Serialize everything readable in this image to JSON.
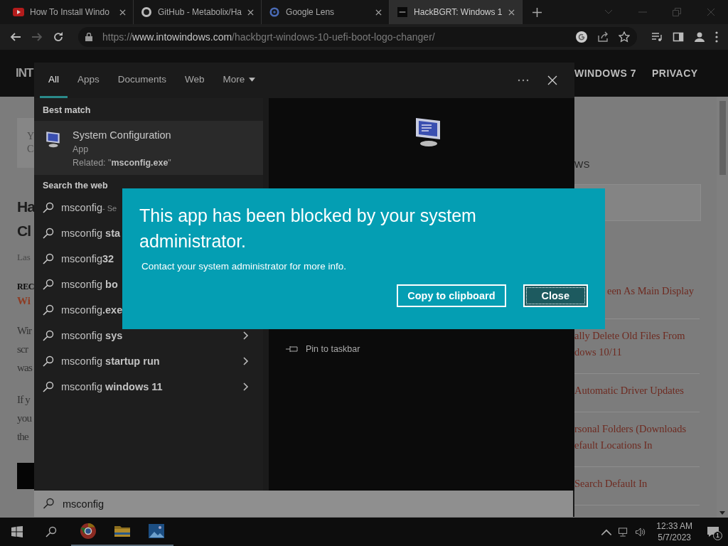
{
  "browser": {
    "tabs": [
      {
        "title": "How To Install Windo",
        "selected": false
      },
      {
        "title": "GitHub - Metabolix/Ha",
        "selected": false
      },
      {
        "title": "Google Lens",
        "selected": false
      },
      {
        "title": "HackBGRT: Windows 1",
        "selected": true
      }
    ],
    "back_disabled": false,
    "forward_disabled": true,
    "url": {
      "scheme": "https://",
      "host": "www.intowindows.com",
      "path": "/hackbgrt-windows-10-uefi-boot-logo-changer/"
    }
  },
  "site": {
    "logo": "INT",
    "nav": [
      "WINDOWS 7",
      "PRIVACY"
    ],
    "left_fragments": [
      {
        "kind": "boxed",
        "lines": [
          "Y",
          "C"
        ]
      },
      {
        "kind": "title",
        "lines": [
          "Ha",
          "Cl"
        ]
      },
      {
        "kind": "meta",
        "lines": [
          "Las"
        ]
      },
      {
        "kind": "bold",
        "lines": [
          "REC"
        ]
      },
      {
        "kind": "link",
        "lines": [
          "Wi"
        ]
      },
      {
        "kind": "para",
        "lines": [
          "Wir",
          "scr",
          "was"
        ]
      },
      {
        "kind": "para",
        "lines": [
          "If y",
          "you",
          "the"
        ]
      },
      {
        "kind": "block"
      }
    ],
    "sidebar_heading": "WS",
    "links": [
      {
        "lines": [
          "een As Main Display"
        ]
      },
      {
        "lines": [
          "ally Delete Old Files From",
          "dows 10/11"
        ]
      },
      {
        "lines": [
          "Automatic Driver Updates"
        ]
      },
      {
        "lines": [
          "rsonal Folders (Downloads",
          "efault Locations In"
        ]
      },
      {
        "lines": [
          "Search Default In"
        ]
      }
    ]
  },
  "search": {
    "tabs": [
      {
        "kind": "tab",
        "label": "All",
        "selected": true
      },
      {
        "kind": "tab",
        "label": "Apps",
        "selected": false
      },
      {
        "kind": "tab",
        "label": "Documents",
        "selected": false
      },
      {
        "kind": "tab",
        "label": "Web",
        "selected": false
      },
      {
        "kind": "menu",
        "label": "More",
        "selected": false
      }
    ],
    "best_match_heading": "Best match",
    "best_match": {
      "name": "System Configuration",
      "type": "App",
      "related": "Related: \"**msconfig.exe**\""
    },
    "web_heading": "Search the web",
    "results": [
      {
        "text": "msconfig",
        "suffix": "- Se"
      },
      {
        "text": "msconfig **sta**"
      },
      {
        "text": "msconfig**32**"
      },
      {
        "text": "msconfig **bo**"
      },
      {
        "text": "msconfig**.exe**"
      },
      {
        "text": "msconfig **sys**",
        "chevron": true
      },
      {
        "text": "msconfig **startup run**",
        "chevron": true
      },
      {
        "text": "msconfig **windows 11**",
        "chevron": true
      }
    ],
    "actions": [
      {
        "label": "Pin to taskbar"
      }
    ],
    "query": "msconfig"
  },
  "dialog": {
    "title": "This app has been blocked by your system administrator.",
    "message": "Contact your system administrator for more info.",
    "buttons": [
      {
        "label": "Copy to clipboard",
        "focused": false
      },
      {
        "label": "Close",
        "focused": true
      }
    ]
  },
  "taskbar": {
    "apps": [
      {
        "kind": "chrome",
        "running": true
      },
      {
        "kind": "folder",
        "running": true
      },
      {
        "kind": "photos",
        "running": true
      }
    ],
    "time": "12:33 AM",
    "date": "5/7/2023",
    "notifications": "1"
  }
}
